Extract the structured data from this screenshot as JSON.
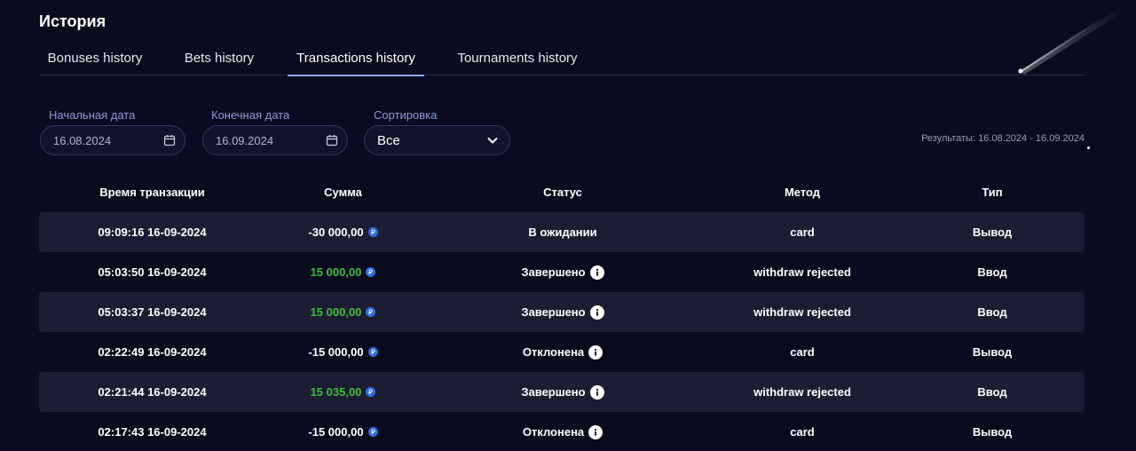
{
  "page_title": "История",
  "tabs": [
    {
      "label": "Bonuses history",
      "active": false
    },
    {
      "label": "Bets history",
      "active": false
    },
    {
      "label": "Transactions history",
      "active": true
    },
    {
      "label": "Tournaments history",
      "active": false
    }
  ],
  "filters": {
    "start_label": "Начальная дата",
    "start_value": "16.08.2024",
    "end_label": "Конечная дата",
    "end_value": "16.09.2024",
    "sort_label": "Сортировка",
    "sort_value": "Все"
  },
  "results_text": "Результаты: 16.08.2024 - 16.09.2024",
  "table": {
    "headers": [
      "Время транзакции",
      "Сумма",
      "Статус",
      "Метод",
      "Тип"
    ],
    "rows": [
      {
        "time": "09:09:16 16-09-2024",
        "amount": "-30 000,00",
        "positive": false,
        "status": "В ожидании",
        "info": false,
        "method": "card",
        "type": "Вывод"
      },
      {
        "time": "05:03:50 16-09-2024",
        "amount": "15 000,00",
        "positive": true,
        "status": "Завершено",
        "info": true,
        "method": "withdraw rejected",
        "type": "Ввод"
      },
      {
        "time": "05:03:37 16-09-2024",
        "amount": "15 000,00",
        "positive": true,
        "status": "Завершено",
        "info": true,
        "method": "withdraw rejected",
        "type": "Ввод"
      },
      {
        "time": "02:22:49 16-09-2024",
        "amount": "-15 000,00",
        "positive": false,
        "status": "Отклонена",
        "info": true,
        "method": "card",
        "type": "Вывод"
      },
      {
        "time": "02:21:44 16-09-2024",
        "amount": "15 035,00",
        "positive": true,
        "status": "Завершено",
        "info": true,
        "method": "withdraw rejected",
        "type": "Ввод"
      },
      {
        "time": "02:17:43 16-09-2024",
        "amount": "-15 000,00",
        "positive": false,
        "status": "Отклонена",
        "info": true,
        "method": "card",
        "type": "Вывод"
      }
    ]
  },
  "colors": {
    "background": "#0b0b1f",
    "accent": "#8aa8f0",
    "positive": "#3cc23c",
    "coin": "#2f6fe0",
    "row_shade": "#1c1d33"
  }
}
